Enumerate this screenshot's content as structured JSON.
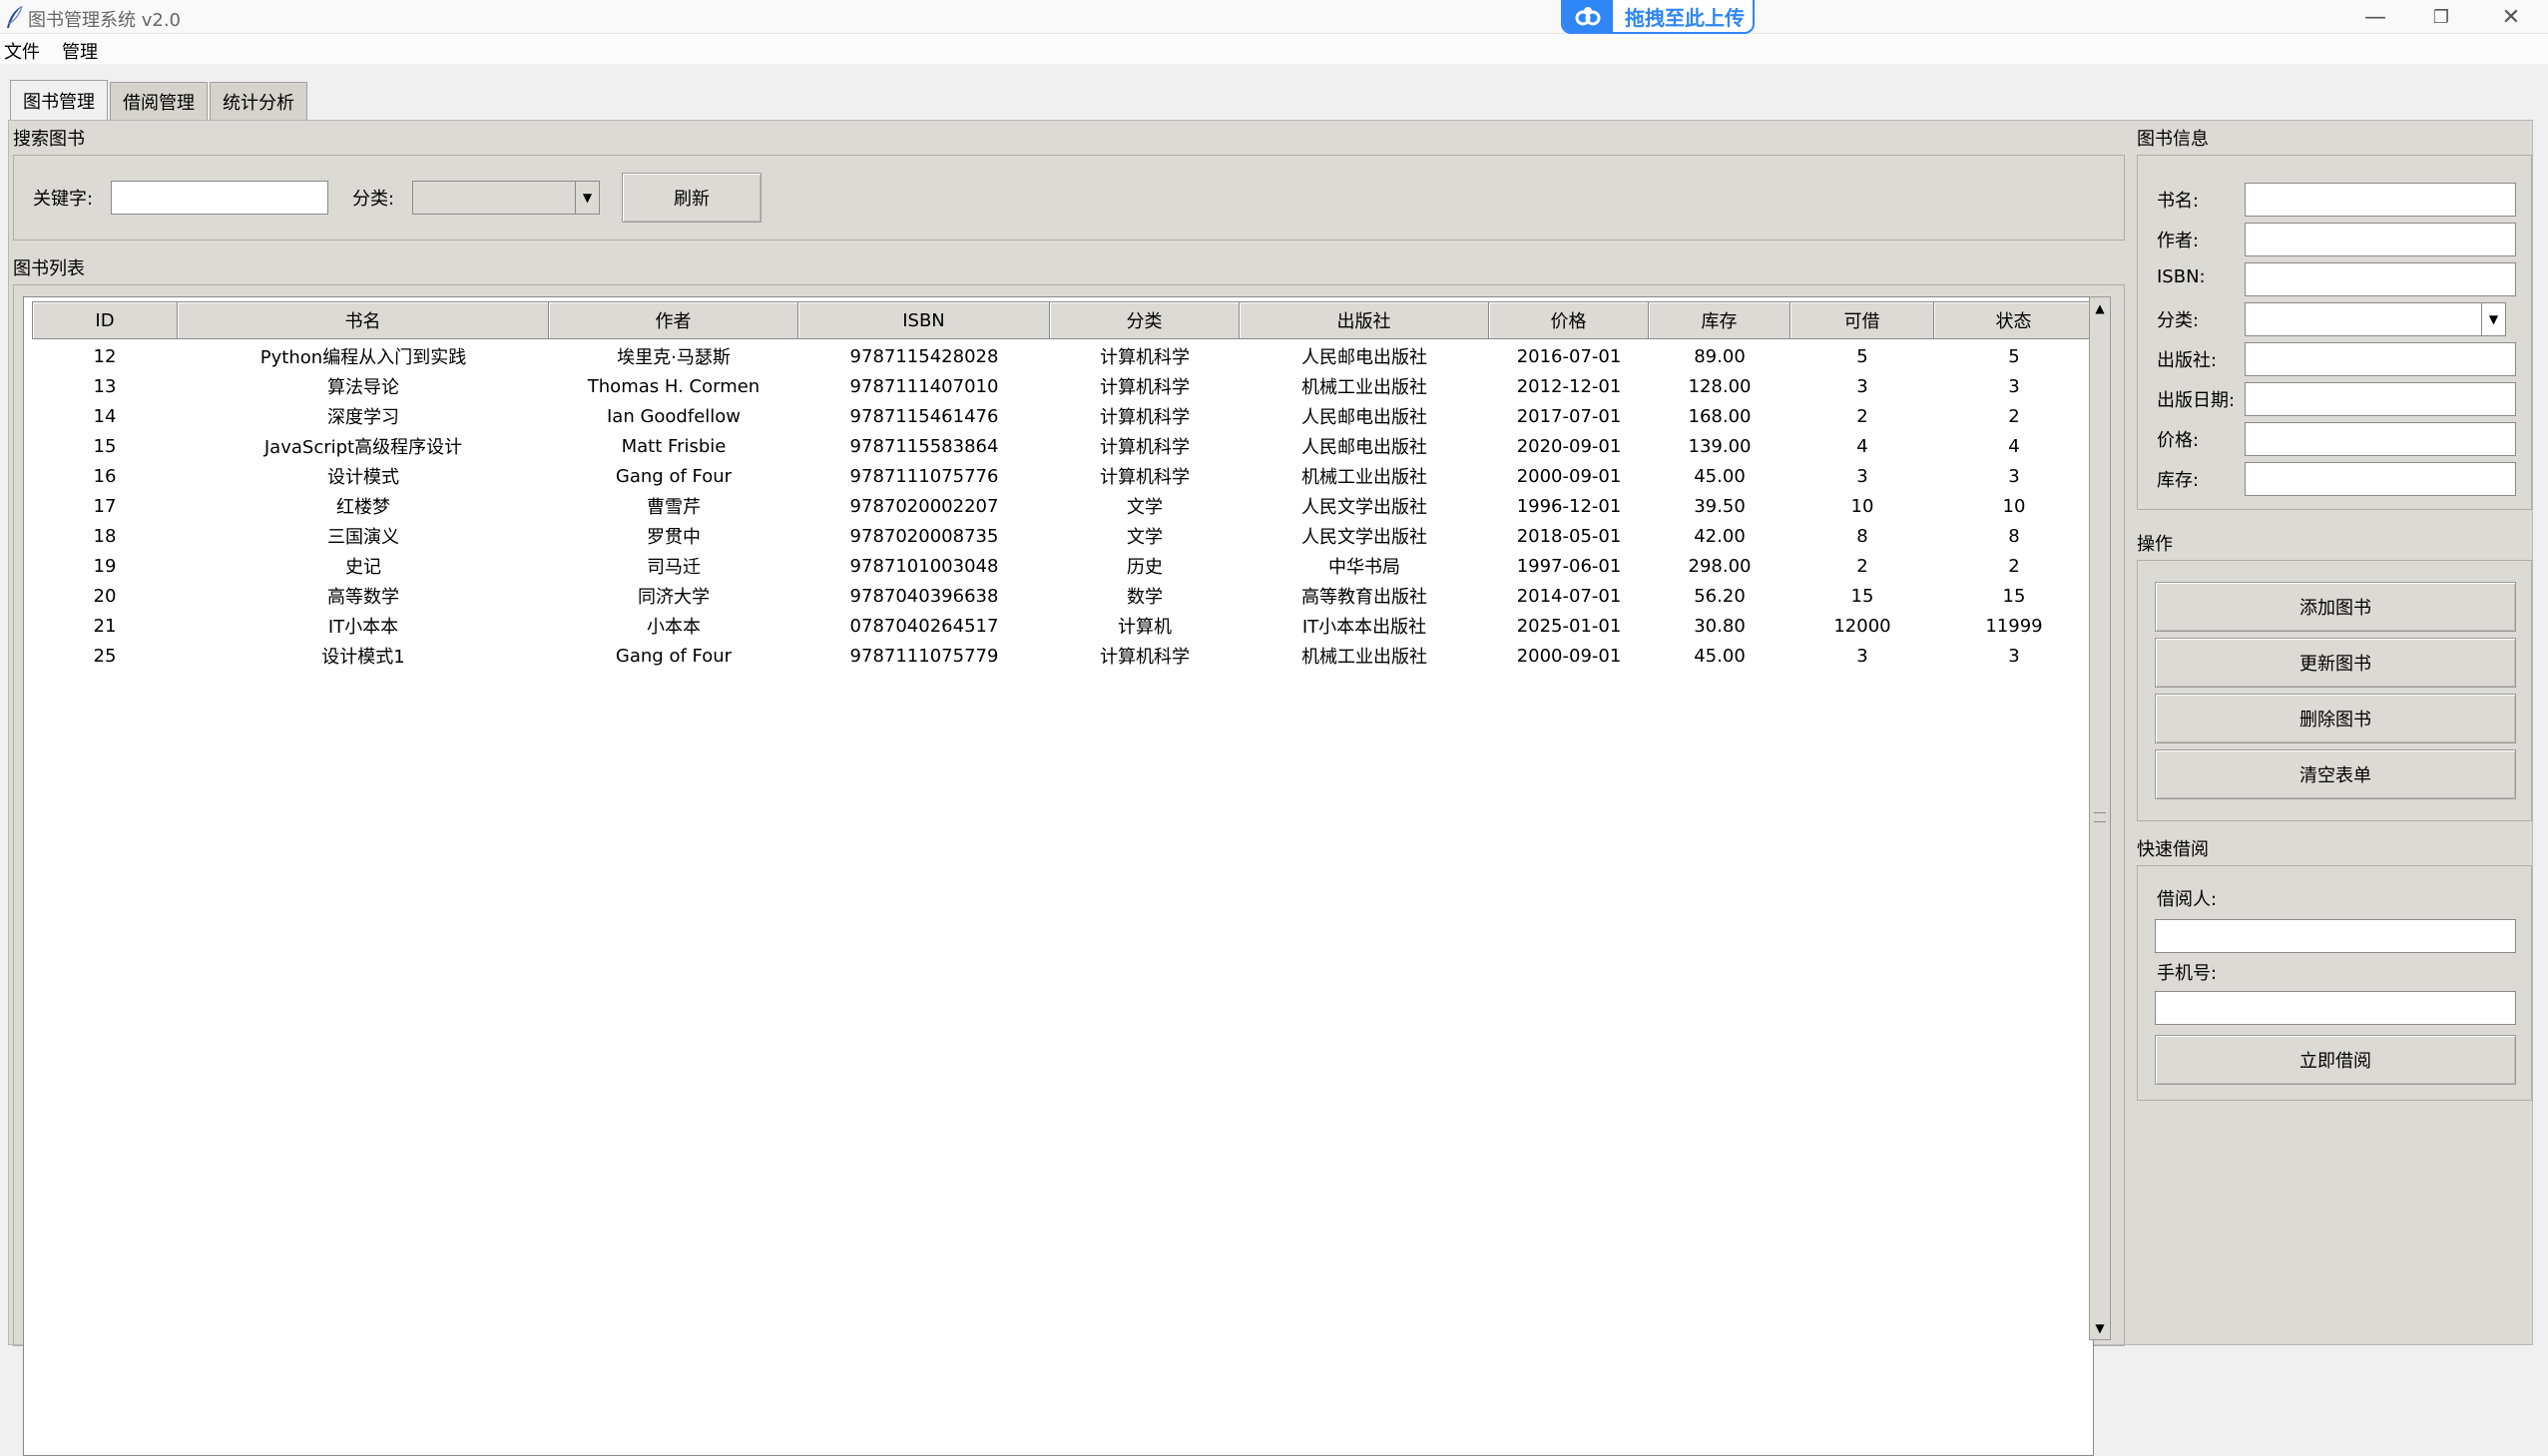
{
  "window": {
    "title": "图书管理系统 v2.0",
    "upload_badge": "拖拽至此上传",
    "minimize": "—",
    "restore": "❐",
    "close": "✕"
  },
  "menubar": {
    "items": [
      "文件",
      "管理"
    ]
  },
  "tabs": [
    "图书管理",
    "借阅管理",
    "统计分析"
  ],
  "search": {
    "section_title": "搜索图书",
    "keyword_label": "关键字:",
    "keyword_value": "",
    "category_label": "分类:",
    "category_value": "",
    "refresh_label": "刷新"
  },
  "book_list": {
    "section_title": "图书列表",
    "columns": [
      "ID",
      "书名",
      "作者",
      "ISBN",
      "分类",
      "出版社",
      "价格",
      "库存",
      "可借",
      "状态"
    ],
    "rows": [
      [
        "12",
        "Python编程从入门到实践",
        "埃里克·马瑟斯",
        "9787115428028",
        "计算机科学",
        "人民邮电出版社",
        "2016-07-01",
        "89.00",
        "5",
        "5"
      ],
      [
        "13",
        "算法导论",
        "Thomas H. Cormen",
        "9787111407010",
        "计算机科学",
        "机械工业出版社",
        "2012-12-01",
        "128.00",
        "3",
        "3"
      ],
      [
        "14",
        "深度学习",
        "Ian Goodfellow",
        "9787115461476",
        "计算机科学",
        "人民邮电出版社",
        "2017-07-01",
        "168.00",
        "2",
        "2"
      ],
      [
        "15",
        "JavaScript高级程序设计",
        "Matt Frisbie",
        "9787115583864",
        "计算机科学",
        "人民邮电出版社",
        "2020-09-01",
        "139.00",
        "4",
        "4"
      ],
      [
        "16",
        "设计模式",
        "Gang of Four",
        "9787111075776",
        "计算机科学",
        "机械工业出版社",
        "2000-09-01",
        "45.00",
        "3",
        "3"
      ],
      [
        "17",
        "红楼梦",
        "曹雪芹",
        "9787020002207",
        "文学",
        "人民文学出版社",
        "1996-12-01",
        "39.50",
        "10",
        "10"
      ],
      [
        "18",
        "三国演义",
        "罗贯中",
        "9787020008735",
        "文学",
        "人民文学出版社",
        "2018-05-01",
        "42.00",
        "8",
        "8"
      ],
      [
        "19",
        "史记",
        "司马迁",
        "9787101003048",
        "历史",
        "中华书局",
        "1997-06-01",
        "298.00",
        "2",
        "2"
      ],
      [
        "20",
        "高等数学",
        "同济大学",
        "9787040396638",
        "数学",
        "高等教育出版社",
        "2014-07-01",
        "56.20",
        "15",
        "15"
      ],
      [
        "21",
        "IT小本本",
        "小本本",
        "0787040264517",
        "计算机",
        "IT小本本出版社",
        "2025-01-01",
        "30.80",
        "12000",
        "11999"
      ],
      [
        "25",
        "设计模式1",
        "Gang of Four",
        "9787111075779",
        "计算机科学",
        "机械工业出版社",
        "2000-09-01",
        "45.00",
        "3",
        "3"
      ]
    ]
  },
  "book_info": {
    "section_title": "图书信息",
    "fields": [
      {
        "label": "书名:",
        "value": ""
      },
      {
        "label": "作者:",
        "value": ""
      },
      {
        "label": "ISBN:",
        "value": ""
      },
      {
        "label": "分类:",
        "value": ""
      },
      {
        "label": "出版社:",
        "value": ""
      },
      {
        "label": "出版日期:",
        "value": ""
      },
      {
        "label": "价格:",
        "value": ""
      },
      {
        "label": "库存:",
        "value": ""
      }
    ]
  },
  "operations": {
    "section_title": "操作",
    "add": "添加图书",
    "update": "更新图书",
    "delete": "删除图书",
    "clear": "清空表单"
  },
  "quick_borrow": {
    "section_title": "快速借阅",
    "borrower_label": "借阅人:",
    "borrower_value": "",
    "phone_label": "手机号:",
    "phone_value": "",
    "borrow_button": "立即借阅"
  },
  "colors": {
    "accent": "#2f86f6",
    "panel": "#dcdad5",
    "background": "#f0f0f0"
  }
}
